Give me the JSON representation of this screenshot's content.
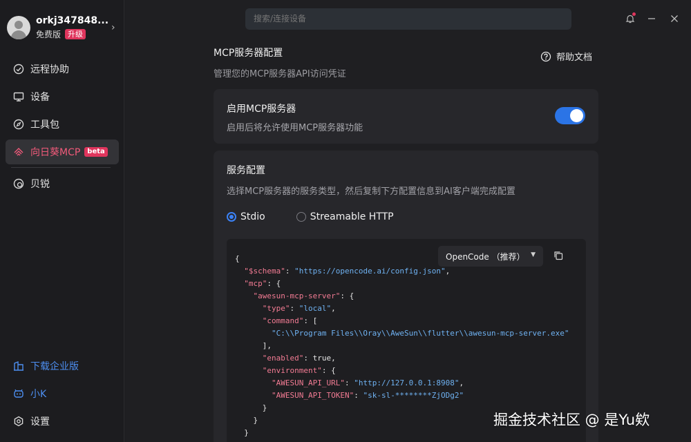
{
  "sidebar": {
    "username": "orkj347848...",
    "plan": "免费版",
    "upgrade_label": "升级",
    "items": [
      {
        "label": "远程协助",
        "icon": "remote-assist-icon"
      },
      {
        "label": "设备",
        "icon": "monitor-icon"
      },
      {
        "label": "工具包",
        "icon": "compass-icon"
      },
      {
        "label": "向日葵MCP",
        "icon": "mcp-icon",
        "badge": "beta"
      },
      {
        "label": "贝锐",
        "icon": "oray-icon"
      }
    ],
    "bottom": [
      {
        "label": "下载企业版",
        "icon": "building-icon"
      },
      {
        "label": "小K",
        "icon": "bot-icon"
      },
      {
        "label": "设置",
        "icon": "gear-icon"
      }
    ]
  },
  "topbar": {
    "search_placeholder": "搜索/连接设备"
  },
  "main": {
    "title": "MCP服务器配置",
    "subtitle": "管理您的MCP服务器API访问凭证",
    "help_label": "帮助文档",
    "enable_card": {
      "title": "启用MCP服务器",
      "subtitle": "启用后将允许使用MCP服务器功能",
      "enabled": true
    },
    "service_card": {
      "title": "服务配置",
      "subtitle": "选择MCP服务器的服务类型，然后复制下方配置信息到AI客户端完成配置",
      "options": [
        "Stdio",
        "Streamable HTTP"
      ],
      "selected": "Stdio",
      "client_select": "OpenCode （推荐）",
      "code": {
        "l1": "{",
        "schema_key": "\"$schema\"",
        "schema_val": "\"https://opencode.ai/config.json\"",
        "mcp_key": "\"mcp\"",
        "server_key": "\"awesun-mcp-server\"",
        "type_key": "\"type\"",
        "type_val": "\"local\"",
        "command_key": "\"command\"",
        "command_val": "\"C:\\\\Program Files\\\\Oray\\\\AweSun\\\\flutter\\\\awesun-mcp-server.exe\"",
        "enabled_key": "\"enabled\"",
        "enabled_val": "true",
        "env_key": "\"environment\"",
        "api_url_key": "\"AWESUN_API_URL\"",
        "api_url_val": "\"http://127.0.0.1:8908\"",
        "api_token_key": "\"AWESUN_API_TOKEN\"",
        "api_token_val": "\"sk-sl-********ZjODg2\""
      }
    }
  },
  "watermark": "掘金技术社区 @ 是Yu欸",
  "colors": {
    "accent_blue": "#2b74e6",
    "accent_pink": "#e0355d",
    "code_key": "#f27b93",
    "code_string": "#6fb2f2"
  }
}
